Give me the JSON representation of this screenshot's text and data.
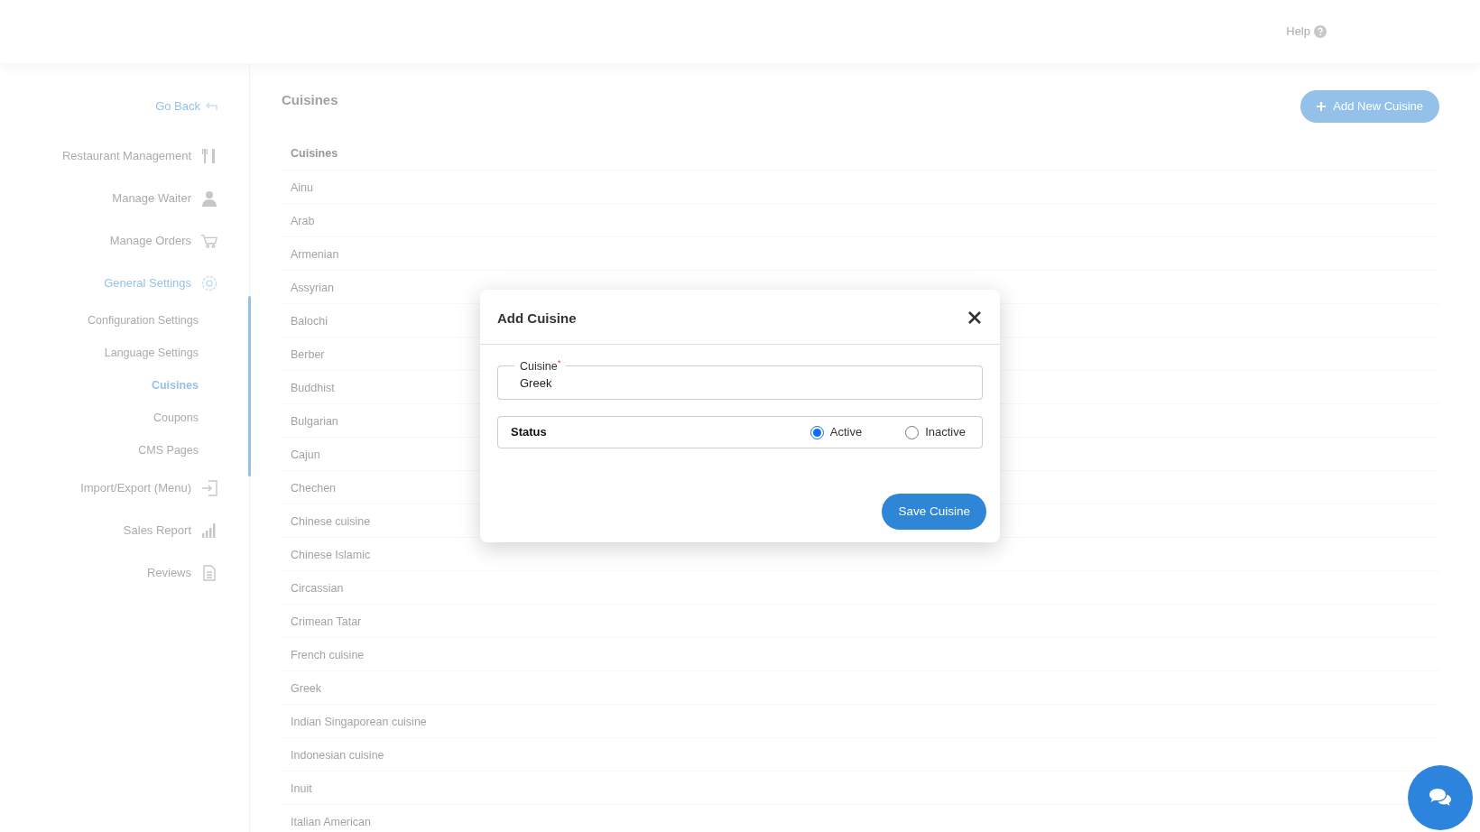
{
  "header": {
    "help": "Help"
  },
  "sidebar": {
    "go_back": "Go Back",
    "items": [
      {
        "label": "Restaurant Management",
        "selected": false
      },
      {
        "label": "Manage Waiter",
        "selected": false
      },
      {
        "label": "Manage Orders",
        "selected": false
      },
      {
        "label": "General Settings",
        "selected": true,
        "children": [
          {
            "label": "Configuration Settings",
            "selected": false
          },
          {
            "label": "Language Settings",
            "selected": false
          },
          {
            "label": "Cuisines",
            "selected": true
          },
          {
            "label": "Coupons",
            "selected": false
          },
          {
            "label": "CMS Pages",
            "selected": false
          }
        ]
      },
      {
        "label": "Import/Export (Menu)",
        "selected": false
      },
      {
        "label": "Sales Report",
        "selected": false
      },
      {
        "label": "Reviews",
        "selected": false
      }
    ]
  },
  "page": {
    "title": "Cuisines",
    "add_button": "Add New Cuisine",
    "table": {
      "columns": [
        "Cuisines"
      ],
      "rows": [
        "Ainu",
        "Arab",
        "Armenian",
        "Assyrian",
        "Balochi",
        "Berber",
        "Buddhist",
        "Bulgarian",
        "Cajun",
        "Chechen",
        "Chinese cuisine",
        "Chinese Islamic",
        "Circassian",
        "Crimean Tatar",
        "French cuisine",
        "Greek",
        "Indian Singaporean cuisine",
        "Indonesian cuisine",
        "Inuit",
        "Italian American"
      ]
    }
  },
  "modal": {
    "title": "Add Cuisine",
    "field": {
      "label": "Cuisine",
      "required_mark": "*",
      "value": "Greek"
    },
    "status": {
      "label": "Status",
      "options": [
        {
          "label": "Active",
          "selected": true
        },
        {
          "label": "Inactive",
          "selected": false
        }
      ]
    },
    "save_button": "Save Cuisine"
  }
}
